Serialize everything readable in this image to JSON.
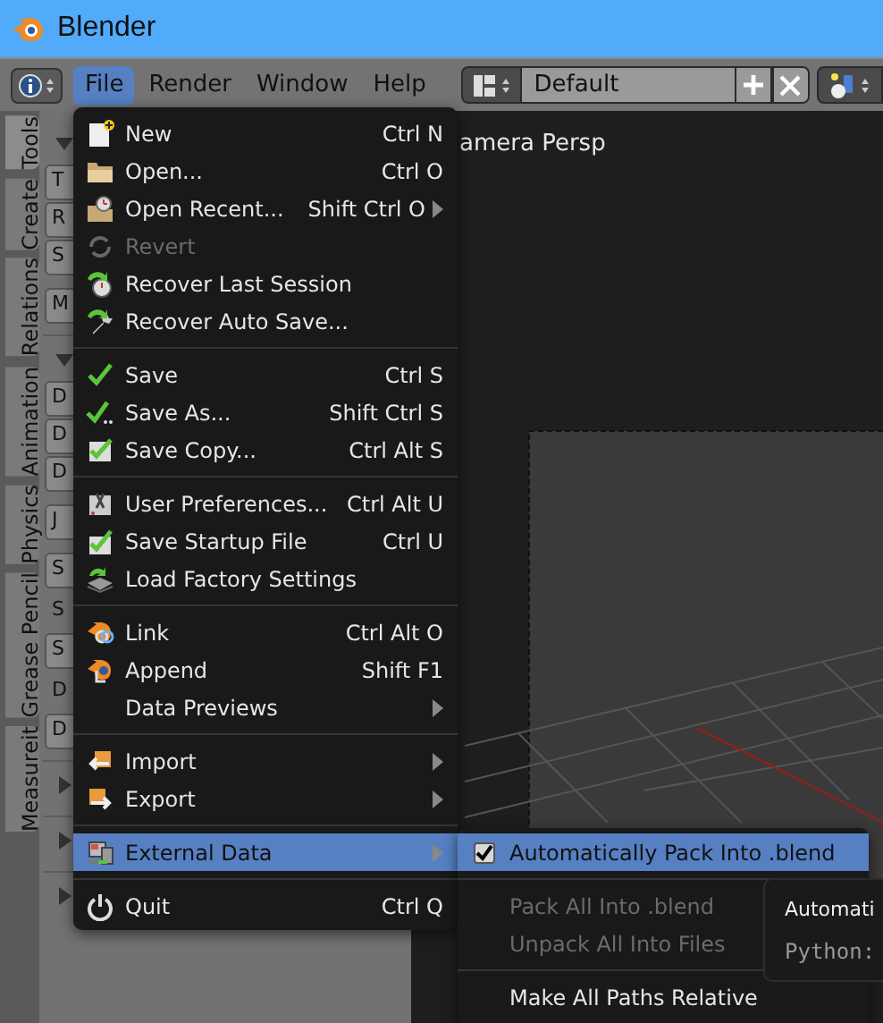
{
  "window": {
    "title": "Blender"
  },
  "header": {
    "menus": [
      {
        "label": "File",
        "selected": true
      },
      {
        "label": "Render",
        "selected": false
      },
      {
        "label": "Window",
        "selected": false
      },
      {
        "label": "Help",
        "selected": false
      }
    ],
    "screen_layout": "Default"
  },
  "side_tabs": [
    {
      "label": "Tools",
      "selected": true
    },
    {
      "label": "Create",
      "selected": false
    },
    {
      "label": "Relations",
      "selected": false
    },
    {
      "label": "Animation",
      "selected": false
    },
    {
      "label": "Physics",
      "selected": false
    },
    {
      "label": "Grease Pencil",
      "selected": false
    },
    {
      "label": "Measureit",
      "selected": false
    }
  ],
  "tool_shelf": [
    {
      "kind": "header",
      "expanded": true
    },
    {
      "kind": "button",
      "text": "T"
    },
    {
      "kind": "button",
      "text": "R"
    },
    {
      "kind": "button",
      "text": "S"
    },
    {
      "kind": "gap"
    },
    {
      "kind": "button",
      "text": "M"
    },
    {
      "kind": "separator"
    },
    {
      "kind": "header",
      "expanded": true
    },
    {
      "kind": "button",
      "text": "D"
    },
    {
      "kind": "button",
      "text": "D"
    },
    {
      "kind": "button",
      "text": "D"
    },
    {
      "kind": "gap"
    },
    {
      "kind": "button",
      "text": "J"
    },
    {
      "kind": "gap"
    },
    {
      "kind": "button",
      "text": "S"
    },
    {
      "kind": "label",
      "text": "S"
    },
    {
      "kind": "button",
      "text": "S"
    },
    {
      "kind": "label",
      "text": "D"
    },
    {
      "kind": "button",
      "text": "D"
    },
    {
      "kind": "separator"
    },
    {
      "kind": "header",
      "expanded": false
    },
    {
      "kind": "separator"
    },
    {
      "kind": "header",
      "expanded": false
    },
    {
      "kind": "separator"
    },
    {
      "kind": "header",
      "expanded": false
    }
  ],
  "viewport": {
    "label": "amera Persp"
  },
  "file_menu": [
    {
      "kind": "item",
      "label": "New",
      "shortcut": "Ctrl N",
      "submenu": false,
      "disabled": false,
      "selected": false
    },
    {
      "kind": "item",
      "label": "Open...",
      "shortcut": "Ctrl O",
      "submenu": false,
      "disabled": false,
      "selected": false
    },
    {
      "kind": "item",
      "label": "Open Recent...",
      "shortcut": "Shift Ctrl O",
      "submenu": true,
      "disabled": false,
      "selected": false
    },
    {
      "kind": "item",
      "label": "Revert",
      "submenu": false,
      "disabled": true,
      "selected": false
    },
    {
      "kind": "item",
      "label": "Recover Last Session",
      "submenu": false,
      "disabled": false,
      "selected": false
    },
    {
      "kind": "item",
      "label": "Recover Auto Save...",
      "submenu": false,
      "disabled": false,
      "selected": false
    },
    {
      "kind": "separator"
    },
    {
      "kind": "item",
      "label": "Save",
      "shortcut": "Ctrl S",
      "submenu": false,
      "disabled": false,
      "selected": false
    },
    {
      "kind": "item",
      "label": "Save As...",
      "shortcut": "Shift Ctrl S",
      "submenu": false,
      "disabled": false,
      "selected": false
    },
    {
      "kind": "item",
      "label": "Save Copy...",
      "shortcut": "Ctrl Alt S",
      "submenu": false,
      "disabled": false,
      "selected": false
    },
    {
      "kind": "separator"
    },
    {
      "kind": "item",
      "label": "User Preferences...",
      "shortcut": "Ctrl Alt U",
      "submenu": false,
      "disabled": false,
      "selected": false
    },
    {
      "kind": "item",
      "label": "Save Startup File",
      "shortcut": "Ctrl U",
      "submenu": false,
      "disabled": false,
      "selected": false
    },
    {
      "kind": "item",
      "label": "Load Factory Settings",
      "submenu": false,
      "disabled": false,
      "selected": false
    },
    {
      "kind": "separator"
    },
    {
      "kind": "item",
      "label": "Link",
      "shortcut": "Ctrl Alt O",
      "submenu": false,
      "disabled": false,
      "selected": false
    },
    {
      "kind": "item",
      "label": "Append",
      "shortcut": "Shift F1",
      "submenu": false,
      "disabled": false,
      "selected": false
    },
    {
      "kind": "item",
      "label": "Data Previews",
      "submenu": true,
      "disabled": false,
      "selected": false
    },
    {
      "kind": "separator"
    },
    {
      "kind": "item",
      "label": "Import",
      "submenu": true,
      "disabled": false,
      "selected": false
    },
    {
      "kind": "item",
      "label": "Export",
      "submenu": true,
      "disabled": false,
      "selected": false
    },
    {
      "kind": "separator"
    },
    {
      "kind": "item",
      "label": "External Data",
      "submenu": true,
      "disabled": false,
      "selected": true
    },
    {
      "kind": "separator"
    },
    {
      "kind": "item",
      "label": "Quit",
      "shortcut": "Ctrl Q",
      "submenu": false,
      "disabled": false,
      "selected": false
    }
  ],
  "external_data_menu": [
    {
      "kind": "check",
      "label": "Automatically Pack Into .blend",
      "checked": true,
      "disabled": false,
      "selected": true
    },
    {
      "kind": "separator"
    },
    {
      "kind": "item",
      "label": "Pack All Into .blend",
      "disabled": true,
      "selected": false
    },
    {
      "kind": "item",
      "label": "Unpack All Into Files",
      "disabled": true,
      "selected": false
    },
    {
      "kind": "separator"
    },
    {
      "kind": "item",
      "label": "Make All Paths Relative",
      "disabled": false,
      "selected": false
    }
  ],
  "tooltip": {
    "title": "Automati",
    "python": "Python:"
  }
}
